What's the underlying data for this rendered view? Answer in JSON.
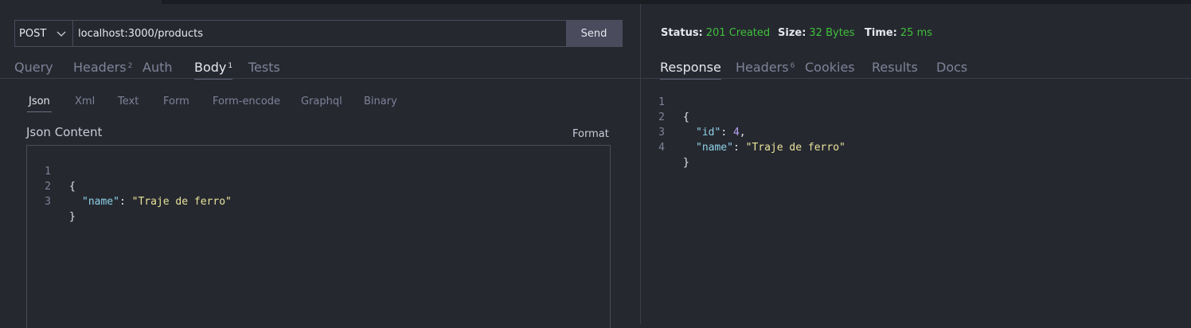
{
  "request": {
    "method": "POST",
    "url": "localhost:3000/products",
    "send_label": "Send"
  },
  "request_tabs": [
    {
      "label": "Query",
      "badge": ""
    },
    {
      "label": "Headers",
      "badge": "2"
    },
    {
      "label": "Auth",
      "badge": ""
    },
    {
      "label": "Body",
      "badge": "1"
    },
    {
      "label": "Tests",
      "badge": ""
    }
  ],
  "body_tabs": [
    "Json",
    "Xml",
    "Text",
    "Form",
    "Form-encode",
    "Graphql",
    "Binary"
  ],
  "body": {
    "title": "Json Content",
    "format_label": "Format",
    "lines": [
      {
        "num": "1",
        "text": "{"
      },
      {
        "num": "2",
        "key": "\"name\"",
        "sep": ": ",
        "value": "\"Traje de ferro\""
      },
      {
        "num": "3",
        "text": "}"
      }
    ]
  },
  "status": {
    "status_label": "Status:",
    "status_value": "201 Created",
    "size_label": "Size:",
    "size_value": "32 Bytes",
    "time_label": "Time:",
    "time_value": "25 ms"
  },
  "response_tabs": [
    {
      "label": "Response",
      "badge": ""
    },
    {
      "label": "Headers",
      "badge": "6"
    },
    {
      "label": "Cookies",
      "badge": ""
    },
    {
      "label": "Results",
      "badge": ""
    },
    {
      "label": "Docs",
      "badge": ""
    }
  ],
  "response": {
    "lines": [
      {
        "num": "1",
        "text": "{"
      },
      {
        "num": "2",
        "key": "\"id\"",
        "sep": ": ",
        "value": "4",
        "tail": ","
      },
      {
        "num": "3",
        "key": "\"name\"",
        "sep": ": ",
        "value": "\"Traje de ferro\""
      },
      {
        "num": "4",
        "text": "}"
      }
    ]
  },
  "colors": {
    "background": "#262830",
    "accent_green": "#3ec13a",
    "json_key": "#8dd3e8",
    "json_string": "#e8e39a"
  },
  "icons": {
    "method_dropdown": "chevron-down-icon"
  }
}
